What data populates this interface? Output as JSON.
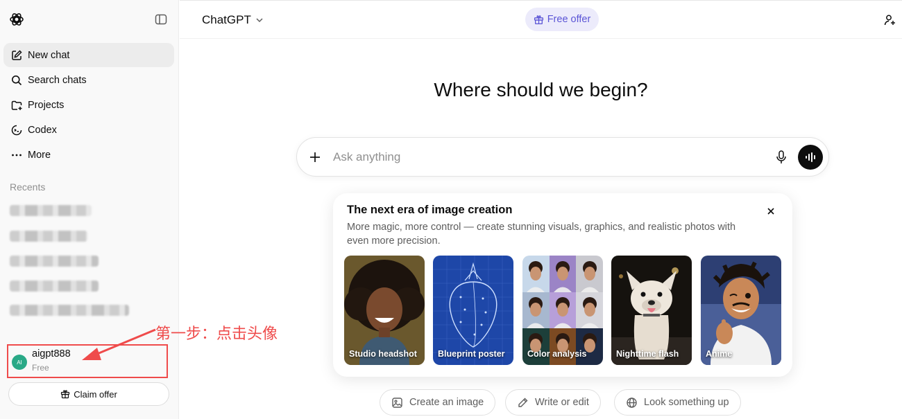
{
  "sidebar": {
    "nav": [
      {
        "label": "New chat",
        "icon": "compose-icon"
      },
      {
        "label": "Search chats",
        "icon": "search-icon"
      },
      {
        "label": "Projects",
        "icon": "folder-icon"
      },
      {
        "label": "Codex",
        "icon": "codex-icon"
      },
      {
        "label": "More",
        "icon": "more-icon"
      }
    ],
    "recents_label": "Recents",
    "user": {
      "initials": "AI",
      "name": "aigpt888",
      "plan": "Free"
    },
    "claim_label": "Claim offer"
  },
  "annotation": {
    "text": "第一步：点击头像",
    "color": "#ef4b4b"
  },
  "header": {
    "model_name": "ChatGPT",
    "offer_label": "Free offer"
  },
  "main": {
    "headline": "Where should we begin?",
    "composer_placeholder": "Ask anything",
    "card": {
      "title": "The next era of image creation",
      "description": "More magic, more control — create stunning visuals, graphics, and realistic photos with even more precision.",
      "tiles": [
        {
          "label": "Studio headshot"
        },
        {
          "label": "Blueprint poster"
        },
        {
          "label": "Color analysis"
        },
        {
          "label": "Nighttime flash"
        },
        {
          "label": "Anime"
        }
      ]
    },
    "suggestions": [
      {
        "label": "Create an image",
        "icon": "image-icon"
      },
      {
        "label": "Write or edit",
        "icon": "pencil-icon"
      },
      {
        "label": "Look something up",
        "icon": "globe-icon"
      }
    ]
  },
  "colors": {
    "accent": "#5b55d6",
    "offer_bg": "#ecebfb",
    "avatar": "#2aa987",
    "annotation": "#ef4b4b"
  }
}
